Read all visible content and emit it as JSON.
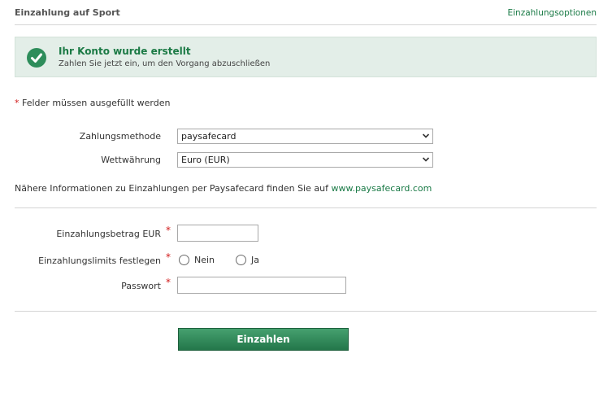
{
  "header": {
    "title": "Einzahlung auf Sport",
    "options_link": "Einzahlungsoptionen"
  },
  "notice": {
    "title": "Ihr Konto wurde erstellt",
    "subtitle": "Zahlen Sie jetzt ein, um den Vorgang abzuschließen",
    "icon": "check-circle-icon",
    "color": "#2e8d5b"
  },
  "required_note": {
    "star": "*",
    "text": " Felder müssen ausgefüllt werden"
  },
  "payment_method": {
    "label": "Zahlungsmethode",
    "value": "paysafecard"
  },
  "currency": {
    "label": "Wettwährung",
    "value": "Euro (EUR)"
  },
  "info": {
    "text": "Nähere Informationen zu Einzahlungen per Paysafecard finden Sie auf ",
    "link": "www.paysafecard.com"
  },
  "amount": {
    "label": "Einzahlungsbetrag EUR",
    "value": ""
  },
  "limits": {
    "label": "Einzahlungslimits festlegen",
    "option_no": "Nein",
    "option_yes": "Ja"
  },
  "password": {
    "label": "Passwort",
    "value": ""
  },
  "required_star": "*",
  "submit_label": "Einzahlen",
  "colors": {
    "accent": "#1a7a46",
    "required": "#d11a1a",
    "notice_bg": "#e3eee8"
  }
}
